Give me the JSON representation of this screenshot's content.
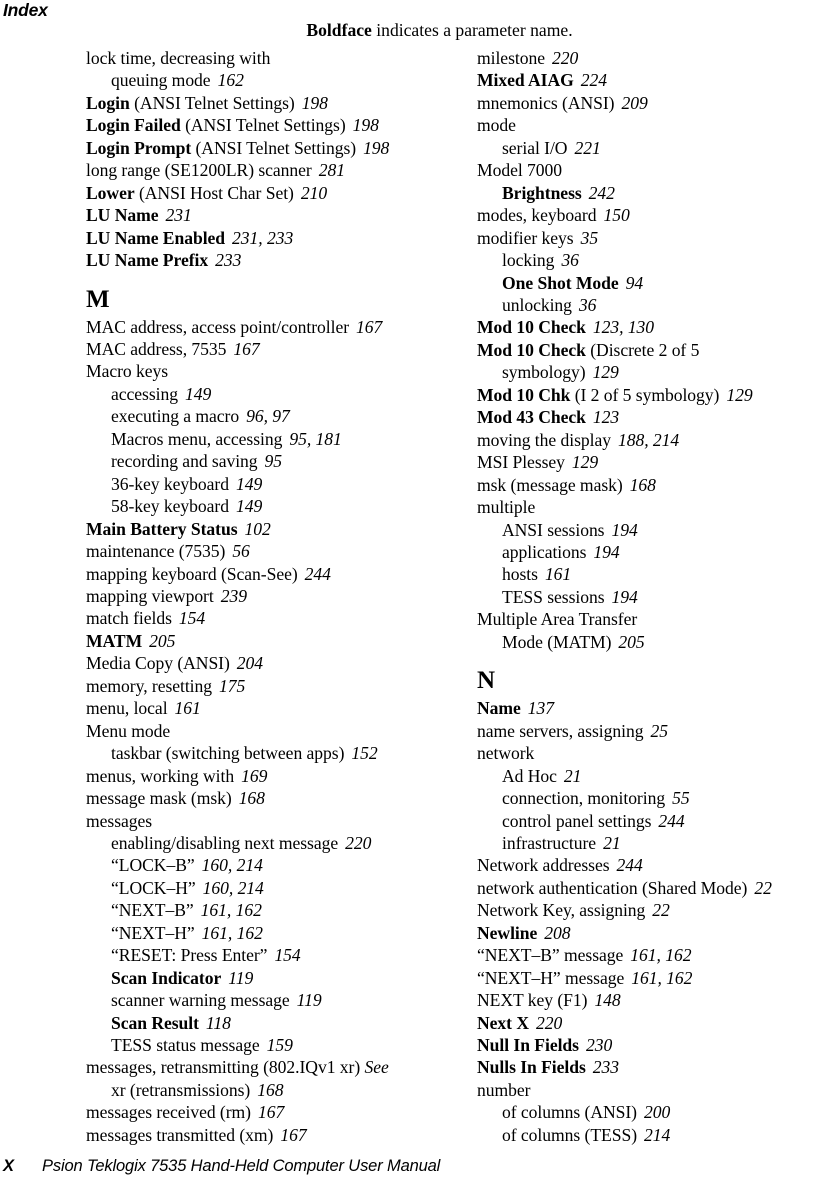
{
  "header": {
    "title": "Index",
    "note_bold": "Boldface",
    "note_rest": " indicates a parameter name."
  },
  "footer": {
    "folio": "X",
    "manual_title": "Psion Teklogix 7535 Hand-Held Computer User Manual"
  },
  "columns": [
    {
      "id": "left",
      "blocks": [
        {
          "kind": "entry",
          "level": 1,
          "term": "lock time, decreasing with",
          "bold": false,
          "qual": "",
          "pages": ""
        },
        {
          "kind": "entry",
          "level": 2,
          "term": "queuing mode",
          "bold": false,
          "qual": "",
          "pages": "162"
        },
        {
          "kind": "entry",
          "level": 1,
          "term": "Login",
          "bold": true,
          "qual": " (ANSI Telnet Settings)",
          "pages": "198"
        },
        {
          "kind": "entry",
          "level": 1,
          "term": "Login Failed",
          "bold": true,
          "qual": " (ANSI Telnet Settings)",
          "pages": "198"
        },
        {
          "kind": "entry",
          "level": 1,
          "term": "Login Prompt",
          "bold": true,
          "qual": " (ANSI Telnet Settings)",
          "pages": "198"
        },
        {
          "kind": "entry",
          "level": 1,
          "term": "long range (SE1200LR) scanner",
          "bold": false,
          "qual": "",
          "pages": "281"
        },
        {
          "kind": "entry",
          "level": 1,
          "term": "Lower",
          "bold": true,
          "qual": "  (ANSI Host Char Set)",
          "pages": "210"
        },
        {
          "kind": "entry",
          "level": 1,
          "term": "LU Name",
          "bold": true,
          "qual": "",
          "pages": "231"
        },
        {
          "kind": "entry",
          "level": 1,
          "term": "LU Name Enabled",
          "bold": true,
          "qual": "",
          "pages": "231, 233"
        },
        {
          "kind": "entry",
          "level": 1,
          "term": "LU Name Prefix",
          "bold": true,
          "qual": "",
          "pages": "233"
        },
        {
          "kind": "letter",
          "letter": "M"
        },
        {
          "kind": "entry",
          "level": 1,
          "term": "MAC address, access point/controller",
          "bold": false,
          "qual": "",
          "pages": "167"
        },
        {
          "kind": "entry",
          "level": 1,
          "term": "MAC address, 7535",
          "bold": false,
          "qual": "",
          "pages": "167"
        },
        {
          "kind": "entry",
          "level": 1,
          "term": "Macro keys",
          "bold": false,
          "qual": "",
          "pages": ""
        },
        {
          "kind": "entry",
          "level": 2,
          "term": "accessing",
          "bold": false,
          "qual": "",
          "pages": "149"
        },
        {
          "kind": "entry",
          "level": 2,
          "term": "executing a macro",
          "bold": false,
          "qual": "",
          "pages": "96, 97"
        },
        {
          "kind": "entry",
          "level": 2,
          "term": "Macros menu, accessing",
          "bold": false,
          "qual": "",
          "pages": "95, 181"
        },
        {
          "kind": "entry",
          "level": 2,
          "term": "recording and saving",
          "bold": false,
          "qual": "",
          "pages": "95"
        },
        {
          "kind": "entry",
          "level": 2,
          "term": "36-key keyboard",
          "bold": false,
          "qual": "",
          "pages": "149"
        },
        {
          "kind": "entry",
          "level": 2,
          "term": "58-key keyboard",
          "bold": false,
          "qual": "",
          "pages": "149"
        },
        {
          "kind": "entry",
          "level": 1,
          "term": "Main Battery Status",
          "bold": true,
          "qual": "",
          "pages": "102"
        },
        {
          "kind": "entry",
          "level": 1,
          "term": "maintenance (7535)",
          "bold": false,
          "qual": "",
          "pages": "56"
        },
        {
          "kind": "entry",
          "level": 1,
          "term": "mapping keyboard (Scan-See)",
          "bold": false,
          "qual": "",
          "pages": "244"
        },
        {
          "kind": "entry",
          "level": 1,
          "term": "mapping viewport",
          "bold": false,
          "qual": "",
          "pages": "239"
        },
        {
          "kind": "entry",
          "level": 1,
          "term": "match fields",
          "bold": false,
          "qual": "",
          "pages": "154"
        },
        {
          "kind": "entry",
          "level": 1,
          "term": "MATM",
          "bold": true,
          "qual": "",
          "pages": "205"
        },
        {
          "kind": "entry",
          "level": 1,
          "term": "Media Copy (ANSI)",
          "bold": false,
          "qual": "",
          "pages": "204"
        },
        {
          "kind": "entry",
          "level": 1,
          "term": "memory, resetting",
          "bold": false,
          "qual": "",
          "pages": "175"
        },
        {
          "kind": "entry",
          "level": 1,
          "term": "menu, local",
          "bold": false,
          "qual": "",
          "pages": "161"
        },
        {
          "kind": "entry",
          "level": 1,
          "term": "Menu mode",
          "bold": false,
          "qual": "",
          "pages": ""
        },
        {
          "kind": "entry",
          "level": 2,
          "term": "taskbar (switching between apps)",
          "bold": false,
          "qual": "",
          "pages": "152"
        },
        {
          "kind": "entry",
          "level": 1,
          "term": "menus, working with",
          "bold": false,
          "qual": "",
          "pages": "169"
        },
        {
          "kind": "entry",
          "level": 1,
          "term": "message mask (msk)",
          "bold": false,
          "qual": "",
          "pages": "168"
        },
        {
          "kind": "entry",
          "level": 1,
          "term": "messages",
          "bold": false,
          "qual": "",
          "pages": ""
        },
        {
          "kind": "entry",
          "level": 2,
          "term": "enabling/disabling next message",
          "bold": false,
          "qual": "",
          "pages": "220"
        },
        {
          "kind": "entry",
          "level": 2,
          "term": "“LOCK–B”",
          "bold": false,
          "qual": "",
          "pages": "160, 214"
        },
        {
          "kind": "entry",
          "level": 2,
          "term": "“LOCK–H”",
          "bold": false,
          "qual": "",
          "pages": "160, 214"
        },
        {
          "kind": "entry",
          "level": 2,
          "term": "“NEXT–B”",
          "bold": false,
          "qual": "",
          "pages": "161, 162"
        },
        {
          "kind": "entry",
          "level": 2,
          "term": "“NEXT–H”",
          "bold": false,
          "qual": "",
          "pages": "161, 162"
        },
        {
          "kind": "entry",
          "level": 2,
          "term": "“RESET: Press Enter”",
          "bold": false,
          "qual": "",
          "pages": "154"
        },
        {
          "kind": "entry",
          "level": 2,
          "term": "Scan Indicator",
          "bold": true,
          "qual": "",
          "pages": "119"
        },
        {
          "kind": "entry",
          "level": 2,
          "term": "scanner warning message",
          "bold": false,
          "qual": "",
          "pages": "119"
        },
        {
          "kind": "entry",
          "level": 2,
          "term": "Scan Result",
          "bold": true,
          "qual": "",
          "pages": "118"
        },
        {
          "kind": "entry",
          "level": 2,
          "term": "TESS status message",
          "bold": false,
          "qual": "",
          "pages": "159"
        },
        {
          "kind": "entry",
          "level": 1,
          "term": "messages, retransmitting (802.IQv1 xr)",
          "bold": false,
          "qual": "",
          "pages": "",
          "seealso": " See"
        },
        {
          "kind": "entry",
          "level": 2,
          "term": "xr (retransmissions)",
          "bold": false,
          "qual": "",
          "pages": "168"
        },
        {
          "kind": "entry",
          "level": 1,
          "term": "messages received (rm)",
          "bold": false,
          "qual": "",
          "pages": "167"
        },
        {
          "kind": "entry",
          "level": 1,
          "term": "messages transmitted (xm)",
          "bold": false,
          "qual": "",
          "pages": "167"
        }
      ]
    },
    {
      "id": "right",
      "blocks": [
        {
          "kind": "entry",
          "level": 1,
          "term": "milestone",
          "bold": false,
          "qual": "",
          "pages": "220"
        },
        {
          "kind": "entry",
          "level": 1,
          "term": "Mixed AIAG",
          "bold": true,
          "qual": "",
          "pages": "224"
        },
        {
          "kind": "entry",
          "level": 1,
          "term": "mnemonics (ANSI)",
          "bold": false,
          "qual": "",
          "pages": "209"
        },
        {
          "kind": "entry",
          "level": 1,
          "term": "mode",
          "bold": false,
          "qual": "",
          "pages": ""
        },
        {
          "kind": "entry",
          "level": 2,
          "term": "serial I/O",
          "bold": false,
          "qual": "",
          "pages": "221"
        },
        {
          "kind": "entry",
          "level": 1,
          "term": "Model 7000",
          "bold": false,
          "qual": "",
          "pages": ""
        },
        {
          "kind": "entry",
          "level": 2,
          "term": "Brightness",
          "bold": true,
          "qual": "",
          "pages": "242"
        },
        {
          "kind": "entry",
          "level": 1,
          "term": "modes, keyboard",
          "bold": false,
          "qual": "",
          "pages": "150"
        },
        {
          "kind": "entry",
          "level": 1,
          "term": "modifier keys",
          "bold": false,
          "qual": "",
          "pages": "35"
        },
        {
          "kind": "entry",
          "level": 2,
          "term": "locking",
          "bold": false,
          "qual": "",
          "pages": "36"
        },
        {
          "kind": "entry",
          "level": 2,
          "term": "One Shot Mode",
          "bold": true,
          "qual": "",
          "pages": "94"
        },
        {
          "kind": "entry",
          "level": 2,
          "term": "unlocking",
          "bold": false,
          "qual": "",
          "pages": "36"
        },
        {
          "kind": "entry",
          "level": 1,
          "term": "Mod 10 Check",
          "bold": true,
          "qual": "",
          "pages": "123, 130"
        },
        {
          "kind": "entry",
          "level": 1,
          "term": "Mod 10 Check",
          "bold": true,
          "qual": " (Discrete 2 of 5",
          "pages": ""
        },
        {
          "kind": "entry",
          "level": 2,
          "term": "symbology)",
          "bold": false,
          "qual": "",
          "pages": "129"
        },
        {
          "kind": "entry",
          "level": 1,
          "term": "Mod 10 Chk",
          "bold": true,
          "qual": " (I 2 of 5 symbology)",
          "pages": "129"
        },
        {
          "kind": "entry",
          "level": 1,
          "term": "Mod 43 Check",
          "bold": true,
          "qual": "",
          "pages": "123"
        },
        {
          "kind": "entry",
          "level": 1,
          "term": "moving the display",
          "bold": false,
          "qual": "",
          "pages": "188, 214"
        },
        {
          "kind": "entry",
          "level": 1,
          "term": "MSI Plessey",
          "bold": false,
          "qual": "",
          "pages": "129"
        },
        {
          "kind": "entry",
          "level": 1,
          "term": "msk (message mask)",
          "bold": false,
          "qual": "",
          "pages": "168"
        },
        {
          "kind": "entry",
          "level": 1,
          "term": "multiple",
          "bold": false,
          "qual": "",
          "pages": ""
        },
        {
          "kind": "entry",
          "level": 2,
          "term": "ANSI sessions",
          "bold": false,
          "qual": "",
          "pages": "194"
        },
        {
          "kind": "entry",
          "level": 2,
          "term": "applications",
          "bold": false,
          "qual": "",
          "pages": "194"
        },
        {
          "kind": "entry",
          "level": 2,
          "term": "hosts",
          "bold": false,
          "qual": "",
          "pages": "161"
        },
        {
          "kind": "entry",
          "level": 2,
          "term": "TESS sessions",
          "bold": false,
          "qual": "",
          "pages": "194"
        },
        {
          "kind": "entry",
          "level": 1,
          "term": "Multiple Area Transfer",
          "bold": false,
          "qual": "",
          "pages": ""
        },
        {
          "kind": "entry",
          "level": 2,
          "term": "Mode (MATM)",
          "bold": false,
          "qual": "",
          "pages": "205"
        },
        {
          "kind": "letter",
          "letter": "N"
        },
        {
          "kind": "entry",
          "level": 1,
          "term": "Name",
          "bold": true,
          "qual": "",
          "pages": "137"
        },
        {
          "kind": "entry",
          "level": 1,
          "term": "name servers, assigning",
          "bold": false,
          "qual": "",
          "pages": "25"
        },
        {
          "kind": "entry",
          "level": 1,
          "term": "network",
          "bold": false,
          "qual": "",
          "pages": ""
        },
        {
          "kind": "entry",
          "level": 2,
          "term": "Ad Hoc",
          "bold": false,
          "qual": "",
          "pages": "21"
        },
        {
          "kind": "entry",
          "level": 2,
          "term": "connection, monitoring",
          "bold": false,
          "qual": "",
          "pages": "55"
        },
        {
          "kind": "entry",
          "level": 2,
          "term": "control panel settings",
          "bold": false,
          "qual": "",
          "pages": "244"
        },
        {
          "kind": "entry",
          "level": 2,
          "term": "infrastructure",
          "bold": false,
          "qual": "",
          "pages": "21"
        },
        {
          "kind": "entry",
          "level": 1,
          "term": "Network addresses",
          "bold": false,
          "qual": "",
          "pages": "244"
        },
        {
          "kind": "entry",
          "level": 1,
          "term": "network authentication (Shared Mode)",
          "bold": false,
          "qual": "",
          "pages": "22"
        },
        {
          "kind": "entry",
          "level": 1,
          "term": "Network Key, assigning",
          "bold": false,
          "qual": "",
          "pages": "22"
        },
        {
          "kind": "entry",
          "level": 1,
          "term": "Newline",
          "bold": true,
          "qual": "",
          "pages": "208"
        },
        {
          "kind": "entry",
          "level": 1,
          "term": "“NEXT–B” message",
          "bold": false,
          "qual": "",
          "pages": "161, 162"
        },
        {
          "kind": "entry",
          "level": 1,
          "term": "“NEXT–H” message",
          "bold": false,
          "qual": "",
          "pages": "161, 162"
        },
        {
          "kind": "entry",
          "level": 1,
          "term": "NEXT key (F1)",
          "bold": false,
          "qual": "",
          "pages": "148"
        },
        {
          "kind": "entry",
          "level": 1,
          "term": "Next X",
          "bold": true,
          "qual": "",
          "pages": "220"
        },
        {
          "kind": "entry",
          "level": 1,
          "term": "Null In Fields",
          "bold": true,
          "qual": "",
          "pages": "230"
        },
        {
          "kind": "entry",
          "level": 1,
          "term": "Nulls In Fields",
          "bold": true,
          "qual": "",
          "pages": "233"
        },
        {
          "kind": "entry",
          "level": 1,
          "term": "number",
          "bold": false,
          "qual": "",
          "pages": ""
        },
        {
          "kind": "entry",
          "level": 2,
          "term": "of columns (ANSI)",
          "bold": false,
          "qual": "",
          "pages": "200"
        },
        {
          "kind": "entry",
          "level": 2,
          "term": "of columns (TESS)",
          "bold": false,
          "qual": "",
          "pages": "214"
        }
      ]
    }
  ]
}
